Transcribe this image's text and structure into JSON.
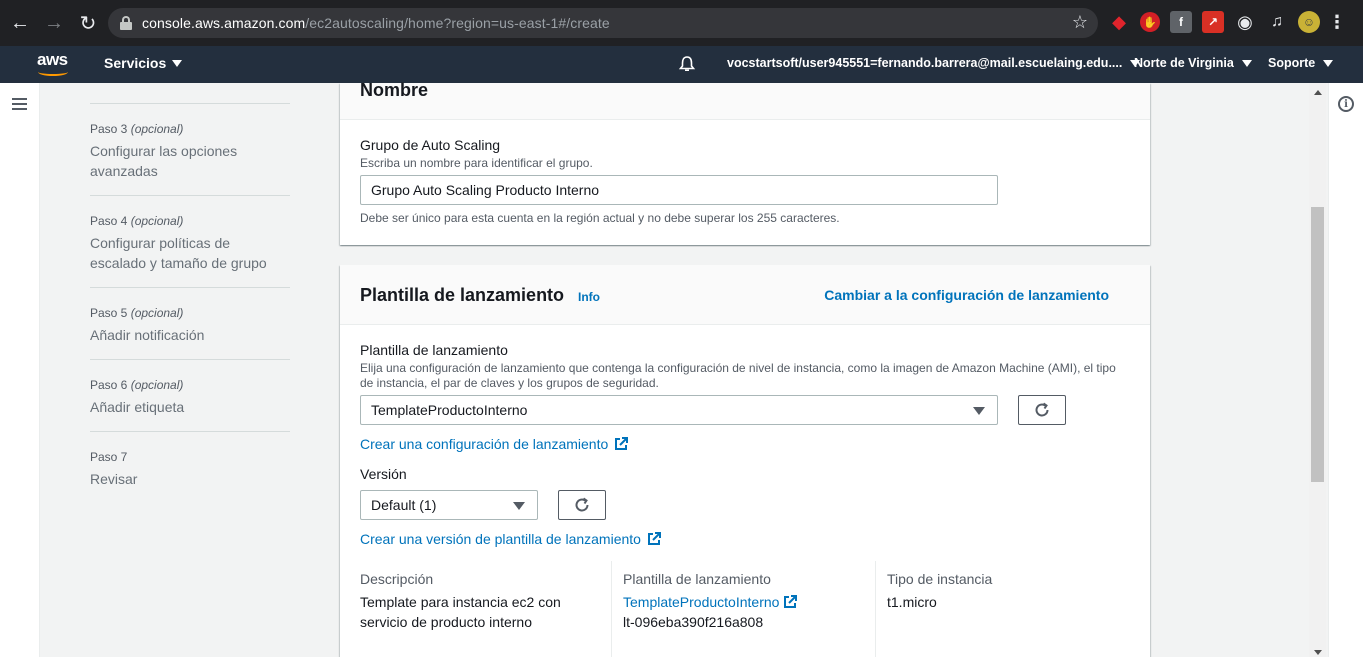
{
  "browser": {
    "url_host": "console.aws.amazon.com",
    "url_path": "/ec2autoscaling/home?region=us-east-1#/create"
  },
  "header": {
    "logo_text": "aws",
    "services_label": "Servicios",
    "account_label": "vocstartsoft/user945551=fernando.barrera@mail.escuelaing.edu....",
    "region_label": "Norte de Virginia",
    "support_label": "Soporte"
  },
  "steps": [
    {
      "num": "Paso 3",
      "tag": "(opcional)",
      "title": "Configurar las opciones avanzadas"
    },
    {
      "num": "Paso 4",
      "tag": "(opcional)",
      "title": "Configurar políticas de escalado y tamaño de grupo"
    },
    {
      "num": "Paso 5",
      "tag": "(opcional)",
      "title": "Añadir notificación"
    },
    {
      "num": "Paso 6",
      "tag": "(opcional)",
      "title": "Añadir etiqueta"
    },
    {
      "num": "Paso 7",
      "tag": "",
      "title": "Revisar"
    }
  ],
  "name_panel": {
    "title": "Nombre",
    "field_label": "Grupo de Auto Scaling",
    "field_desc": "Escriba un nombre para identificar el grupo.",
    "field_value": "Grupo Auto Scaling Producto Interno",
    "field_hint": "Debe ser único para esta cuenta en la región actual y no debe superar los 255 caracteres."
  },
  "template_panel": {
    "title": "Plantilla de lanzamiento",
    "info_label": "Info",
    "switch_link": "Cambiar a la configuración de lanzamiento",
    "template_label": "Plantilla de lanzamiento",
    "template_desc_1": "Elija una configuración de lanzamiento que contenga la configuración de nivel de instancia, como la imagen de Amazon Machine (AMI), el tipo",
    "template_desc_2": "de instancia, el par de claves y los grupos de seguridad.",
    "template_value": "TemplateProductoInterno",
    "create_config_link": "Crear una configuración de lanzamiento",
    "version_label": "Versión",
    "version_value": "Default (1)",
    "create_version_link": "Crear una versión de plantilla de lanzamiento",
    "details": {
      "desc_header": "Descripción",
      "desc_value": "Template para instancia ec2 con servicio de producto interno",
      "template_header": "Plantilla de lanzamiento",
      "template_link": "TemplateProductoInterno",
      "template_id": "lt-096eba390f216a808",
      "type_header": "Tipo de instancia",
      "type_value": "t1.micro"
    }
  }
}
